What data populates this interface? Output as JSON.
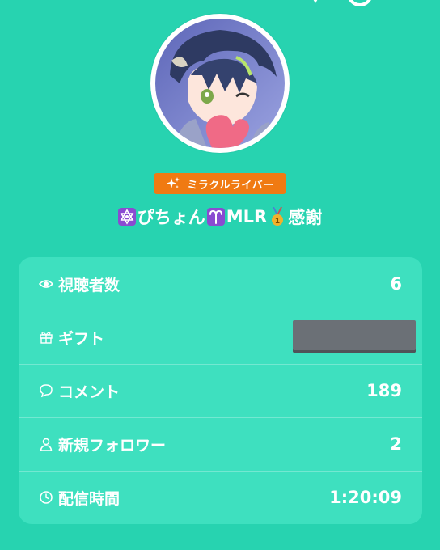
{
  "profile": {
    "rank_badge": "ミラクルライバー",
    "username_text_1": "ぴちょん",
    "username_text_2": "MLR",
    "username_text_3": "感謝"
  },
  "stats": [
    {
      "label": "視聴者数",
      "value": "6",
      "icon": "eye-icon"
    },
    {
      "label": "ギフト",
      "value": "",
      "icon": "gift-icon",
      "redacted": true
    },
    {
      "label": "コメント",
      "value": "189",
      "icon": "comment-icon"
    },
    {
      "label": "新規フォロワー",
      "value": "2",
      "icon": "person-icon"
    },
    {
      "label": "配信時間",
      "value": "1:20:09",
      "icon": "clock-icon"
    }
  ],
  "colors": {
    "background": "#27d3b0",
    "card": "#3ee0bf",
    "badge": "#f07a12",
    "emoji_box": "#8a4bd1",
    "redacted": "#6b7076"
  }
}
